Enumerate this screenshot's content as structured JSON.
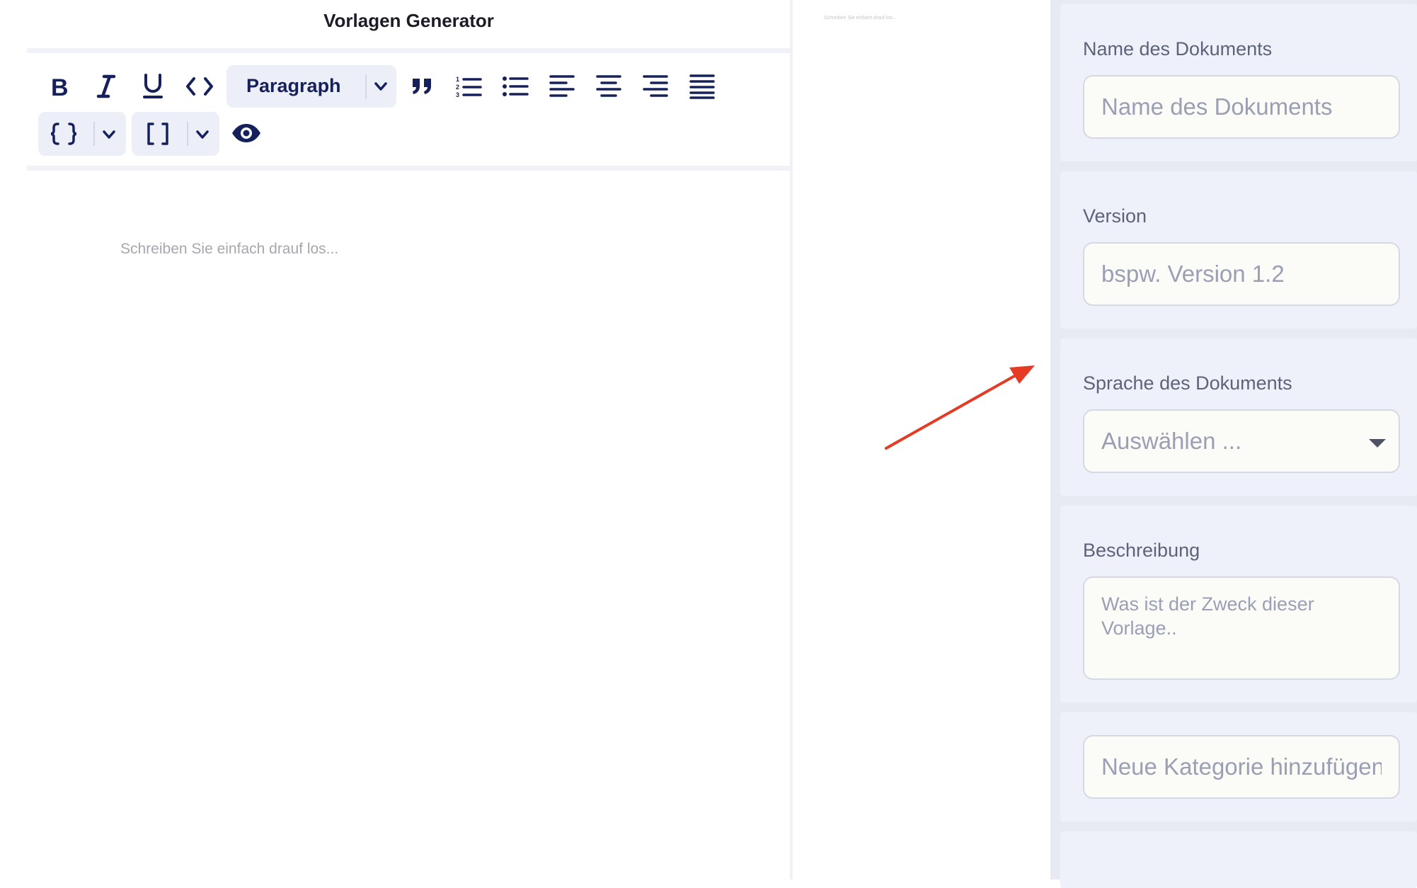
{
  "app": {
    "title": "Vorlagen Generator"
  },
  "toolbar": {
    "bold_icon": "bold-icon",
    "italic_icon": "italic-icon",
    "underline_icon": "underline-icon",
    "code_icon": "code-icon",
    "block_type": {
      "selected": "Paragraph"
    },
    "quote_icon": "quote-icon",
    "ordered_list_icon": "ordered-list-icon",
    "bullet_list_icon": "bullet-list-icon",
    "align_left_icon": "align-left-icon",
    "align_center_icon": "align-center-icon",
    "align_right_icon": "align-right-icon",
    "align_justify_icon": "align-justify-icon",
    "variable_icon": "curly-braces-icon",
    "placeholder_icon": "square-brackets-icon",
    "preview_icon": "eye-icon"
  },
  "editor": {
    "placeholder": "Schreiben Sie einfach drauf los..."
  },
  "preview": {
    "text": "Schreiben Sie einfach drauf los..."
  },
  "annotation": {
    "arrow_color": "#e53b24"
  },
  "settings": {
    "name": {
      "label": "Name des Dokuments",
      "placeholder": "Name des Dokuments"
    },
    "version": {
      "label": "Version",
      "placeholder": "bspw. Version 1.2"
    },
    "language": {
      "label": "Sprache des Dokuments",
      "value": "Auswählen ..."
    },
    "description": {
      "label": "Beschreibung",
      "placeholder": "Was ist der Zweck dieser Vorlage.."
    },
    "category": {
      "placeholder": "Neue Kategorie hinzufügen"
    }
  },
  "colors": {
    "toolbar_icon": "#16205a",
    "panel_bg": "#e8eaf1",
    "card_bg": "#eef0fa",
    "input_bg": "#fbfbf8"
  }
}
